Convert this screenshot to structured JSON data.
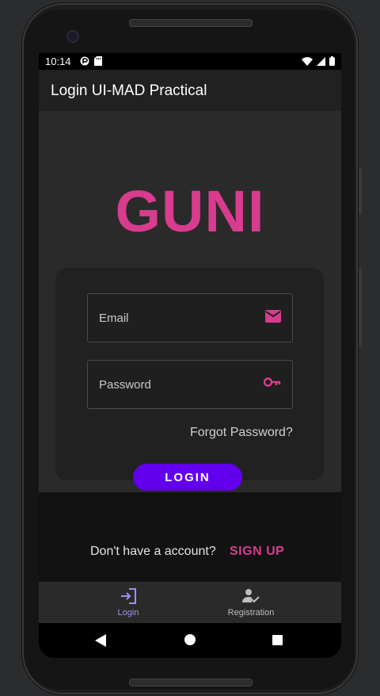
{
  "status": {
    "time": "10:14",
    "icons_left": [
      "notification-icon",
      "sd-card-icon"
    ],
    "icons_right": [
      "wifi-icon",
      "signal-icon",
      "battery-icon"
    ]
  },
  "app": {
    "title": "Login UI-MAD Practical"
  },
  "logo": {
    "text": "GUNI",
    "color": "#d83c8e"
  },
  "form": {
    "email_placeholder": "Email",
    "email_value": "",
    "password_placeholder": "Password",
    "password_value": "",
    "forgot_label": "Forgot Password?",
    "login_label": "LOGIN"
  },
  "signup": {
    "question": "Don't have a account?",
    "link_label": "SIGN UP"
  },
  "bottom_nav": {
    "items": [
      {
        "label": "Login",
        "icon": "login-icon",
        "selected": true
      },
      {
        "label": "Registration",
        "icon": "registration-icon",
        "selected": false
      }
    ]
  },
  "colors": {
    "accent": "#d83c8e",
    "button": "#6200ee",
    "nav_selected": "#a38cf0"
  }
}
